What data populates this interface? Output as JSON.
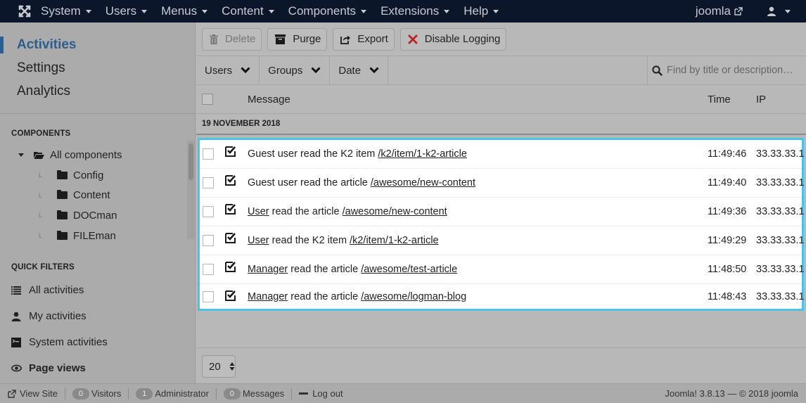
{
  "topbar": {
    "logo": "joomla-logo",
    "menu": [
      {
        "label": "System"
      },
      {
        "label": "Users"
      },
      {
        "label": "Menus"
      },
      {
        "label": "Content"
      },
      {
        "label": "Components"
      },
      {
        "label": "Extensions"
      },
      {
        "label": "Help"
      }
    ],
    "site_link": "joomla",
    "user_icon": "user-icon"
  },
  "sidebar": {
    "nav": [
      {
        "label": "Activities",
        "active": true
      },
      {
        "label": "Settings"
      },
      {
        "label": "Analytics"
      }
    ],
    "components": {
      "title": "COMPONENTS",
      "root": "All components",
      "children": [
        "Config",
        "Content",
        "DOCman",
        "FILEman"
      ]
    },
    "quick_filters": {
      "title": "QUICK FILTERS",
      "items": [
        {
          "label": "All activities",
          "icon": "list-icon"
        },
        {
          "label": "My activities",
          "icon": "user-icon"
        },
        {
          "label": "System activities",
          "icon": "terminal-icon"
        },
        {
          "label": "Page views",
          "icon": "eye-icon",
          "active": true
        }
      ]
    }
  },
  "toolbar": {
    "delete": "Delete",
    "purge": "Purge",
    "export": "Export",
    "disable_logging": "Disable Logging"
  },
  "filters": {
    "users": "Users",
    "groups": "Groups",
    "date": "Date",
    "search_placeholder": "Find by title or description…",
    "search_value": ""
  },
  "table": {
    "columns": {
      "message": "Message",
      "time": "Time",
      "ip": "IP"
    },
    "group_date": "19 NOVEMBER 2018",
    "rows": [
      {
        "actor": "Guest user",
        "actor_link": false,
        "action": "read the K2 item",
        "target": "/k2/item/1-k2-article",
        "time": "11:49:46",
        "ip": "33.33.33.1"
      },
      {
        "actor": "Guest user",
        "actor_link": false,
        "action": "read the article",
        "target": "/awesome/new-content",
        "time": "11:49:40",
        "ip": "33.33.33.1"
      },
      {
        "actor": "User",
        "actor_link": true,
        "action": "read the article",
        "target": "/awesome/new-content",
        "time": "11:49:36",
        "ip": "33.33.33.1"
      },
      {
        "actor": "User",
        "actor_link": true,
        "action": "read the K2 item",
        "target": "/k2/item/1-k2-article",
        "time": "11:49:29",
        "ip": "33.33.33.1"
      },
      {
        "actor": "Manager",
        "actor_link": true,
        "action": "read the article",
        "target": "/awesome/test-article",
        "time": "11:48:50",
        "ip": "33.33.33.1"
      },
      {
        "actor": "Manager",
        "actor_link": true,
        "action": "read the article",
        "target": "/awesome/logman-blog",
        "time": "11:48:43",
        "ip": "33.33.33.1"
      }
    ],
    "limit": "20"
  },
  "statusbar": {
    "view_site": "View Site",
    "visitors_count": "0",
    "visitors": "Visitors",
    "admin_count": "1",
    "admin": "Administrator",
    "messages_count": "0",
    "messages": "Messages",
    "logout": "Log out",
    "version": "Joomla! 3.8.13  —  © 2018 joomla"
  },
  "colors": {
    "topbar": "#0c162a",
    "accent": "#2b5d8e",
    "highlight_border": "#49c3ea",
    "danger": "#b52a2a"
  }
}
